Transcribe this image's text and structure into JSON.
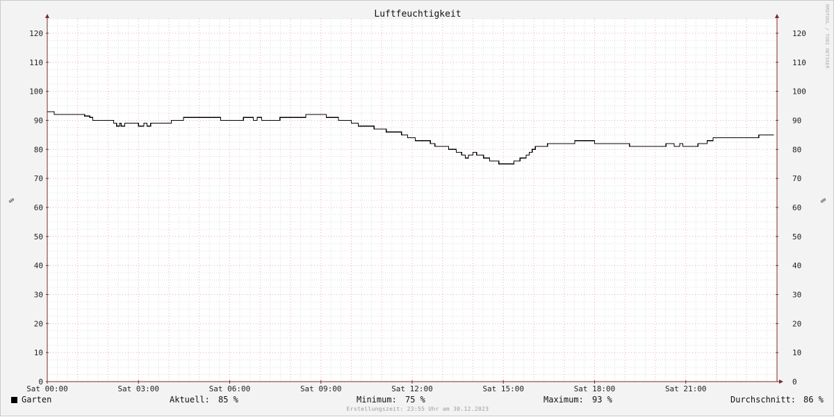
{
  "chart_data": {
    "type": "line",
    "title": "Luftfeuchtigkeit",
    "ylabel": "%",
    "ylim": [
      0,
      125
    ],
    "yticks": [
      0,
      10,
      20,
      30,
      40,
      50,
      60,
      70,
      80,
      90,
      100,
      110,
      120
    ],
    "xlim": [
      0,
      24
    ],
    "xticks": [
      {
        "h": 0,
        "label": "Sat 00:00"
      },
      {
        "h": 3,
        "label": "Sat 03:00"
      },
      {
        "h": 6,
        "label": "Sat 06:00"
      },
      {
        "h": 9,
        "label": "Sat 09:00"
      },
      {
        "h": 12,
        "label": "Sat 12:00"
      },
      {
        "h": 15,
        "label": "Sat 15:00"
      },
      {
        "h": 18,
        "label": "Sat 18:00"
      },
      {
        "h": 21,
        "label": "Sat 21:00"
      }
    ],
    "grid": true,
    "series": [
      {
        "name": "Garten",
        "color": "#000000",
        "step": true,
        "points": [
          [
            0.0,
            93
          ],
          [
            0.23,
            92
          ],
          [
            1.23,
            91.5
          ],
          [
            1.4,
            91
          ],
          [
            1.5,
            90
          ],
          [
            2.18,
            89
          ],
          [
            2.28,
            88
          ],
          [
            2.38,
            89
          ],
          [
            2.43,
            88
          ],
          [
            2.55,
            89
          ],
          [
            3.0,
            88
          ],
          [
            3.18,
            89
          ],
          [
            3.28,
            88
          ],
          [
            3.4,
            89
          ],
          [
            4.08,
            90
          ],
          [
            4.48,
            91
          ],
          [
            5.7,
            90
          ],
          [
            6.45,
            91
          ],
          [
            6.78,
            90
          ],
          [
            6.9,
            91
          ],
          [
            7.05,
            90
          ],
          [
            7.65,
            91
          ],
          [
            8.5,
            92
          ],
          [
            9.18,
            91
          ],
          [
            9.58,
            90
          ],
          [
            10.0,
            89
          ],
          [
            10.23,
            88
          ],
          [
            10.75,
            87
          ],
          [
            11.15,
            86
          ],
          [
            11.65,
            85
          ],
          [
            11.85,
            84
          ],
          [
            12.1,
            83
          ],
          [
            12.6,
            82
          ],
          [
            12.75,
            81
          ],
          [
            13.2,
            80
          ],
          [
            13.45,
            79
          ],
          [
            13.63,
            78
          ],
          [
            13.75,
            77
          ],
          [
            13.85,
            78
          ],
          [
            14.0,
            79
          ],
          [
            14.12,
            78
          ],
          [
            14.35,
            77
          ],
          [
            14.55,
            76
          ],
          [
            14.85,
            75
          ],
          [
            15.35,
            76
          ],
          [
            15.55,
            77
          ],
          [
            15.75,
            78
          ],
          [
            15.85,
            79
          ],
          [
            15.95,
            80
          ],
          [
            16.05,
            81
          ],
          [
            16.45,
            82
          ],
          [
            17.35,
            83
          ],
          [
            18.0,
            82
          ],
          [
            19.15,
            81
          ],
          [
            20.35,
            82
          ],
          [
            20.62,
            81
          ],
          [
            20.8,
            82
          ],
          [
            20.9,
            81
          ],
          [
            21.4,
            82
          ],
          [
            21.7,
            83
          ],
          [
            21.9,
            84
          ],
          [
            23.4,
            85
          ],
          [
            23.9,
            85
          ]
        ]
      }
    ]
  },
  "legend": {
    "series_name": "Garten",
    "current_label": "Aktuell:",
    "current_value": "85 %",
    "min_label": "Minimum:",
    "min_value": "75 %",
    "max_label": "Maximum:",
    "max_value": "93 %",
    "avg_label": "Durchschnitt:",
    "avg_value": "86 %"
  },
  "credit": "Erstellungszeit: 23:55 Uhr am 30.12.2023",
  "watermark": "RRDTOOL / TOBI OETIKER",
  "colors": {
    "background": "#f3f3f3",
    "plot_background": "#ffffff",
    "minor_grid": "#dcdcdc",
    "major_grid": "#e88a8a",
    "axis": "#7a2a2a",
    "line": "#000000"
  }
}
